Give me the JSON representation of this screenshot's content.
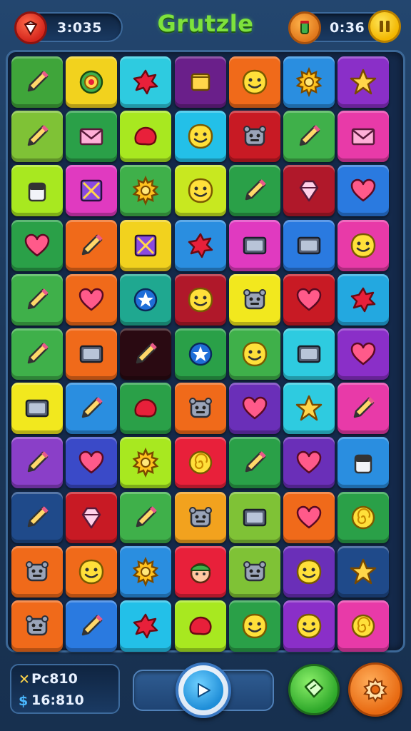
{
  "header": {
    "title": "Grutzle",
    "left_counter": "3:035",
    "right_counter": "0:36"
  },
  "footer": {
    "stat_1_label": "Pc810",
    "stat_2_label": "16:810",
    "stat_1_icon": "cross-icon",
    "stat_2_icon": "dollar-icon"
  },
  "colors": {
    "title": "#7ee23c",
    "board_border": "#3c6897",
    "pause": "#f2b600",
    "play": "#1f8ed8",
    "hint": "#2ea82a",
    "settings": "#e86a12"
  },
  "board": {
    "columns": 7,
    "rows": 11,
    "tiles": [
      [
        {
          "bg": "#3fa53a",
          "icon": "pencil"
        },
        {
          "bg": "#f2d21e",
          "icon": "badge"
        },
        {
          "bg": "#2ecbe0",
          "icon": "splat"
        },
        {
          "bg": "#6a1f8a",
          "icon": "scroll"
        },
        {
          "bg": "#f06a1a",
          "icon": "smiley"
        },
        {
          "bg": "#2a8ee0",
          "icon": "sun"
        },
        {
          "bg": "#8a2fc8",
          "icon": "star"
        }
      ],
      [
        {
          "bg": "#7fc236",
          "icon": "pencil"
        },
        {
          "bg": "#2aa048",
          "icon": "envelope"
        },
        {
          "bg": "#a8e820",
          "icon": "blob"
        },
        {
          "bg": "#23c0e8",
          "icon": "smiley"
        },
        {
          "bg": "#c81a24",
          "icon": "robot"
        },
        {
          "bg": "#3fb04a",
          "icon": "pencil"
        },
        {
          "bg": "#e83aa8",
          "icon": "envelope"
        }
      ],
      [
        {
          "bg": "#a8e820",
          "icon": "jar"
        },
        {
          "bg": "#e03ac0",
          "icon": "crossbox"
        },
        {
          "bg": "#3fb04a",
          "icon": "sun"
        },
        {
          "bg": "#c8e820",
          "icon": "smiley"
        },
        {
          "bg": "#2aa048",
          "icon": "pencil"
        },
        {
          "bg": "#b0182a",
          "icon": "gem"
        },
        {
          "bg": "#2a7ae0",
          "icon": "heart"
        }
      ],
      [
        {
          "bg": "#2aa048",
          "icon": "heart"
        },
        {
          "bg": "#f06a1a",
          "icon": "pencil"
        },
        {
          "bg": "#f2d21e",
          "icon": "crossbox"
        },
        {
          "bg": "#2a8ee0",
          "icon": "splat"
        },
        {
          "bg": "#e03ac0",
          "icon": "tablet"
        },
        {
          "bg": "#2a7ae0",
          "icon": "tablet"
        },
        {
          "bg": "#e83aa8",
          "icon": "smiley"
        }
      ],
      [
        {
          "bg": "#3fb04a",
          "icon": "pencil"
        },
        {
          "bg": "#f06a1a",
          "icon": "heart"
        },
        {
          "bg": "#1fa890",
          "icon": "starcircle"
        },
        {
          "bg": "#b0182a",
          "icon": "smiley"
        },
        {
          "bg": "#f2e81e",
          "icon": "robot"
        },
        {
          "bg": "#c81a24",
          "icon": "heart"
        },
        {
          "bg": "#23a8e0",
          "icon": "splat"
        }
      ],
      [
        {
          "bg": "#3fb04a",
          "icon": "pencil"
        },
        {
          "bg": "#f06a1a",
          "icon": "tablet"
        },
        {
          "bg": "#2a0a12",
          "icon": "pencil"
        },
        {
          "bg": "#2aa048",
          "icon": "starcircle"
        },
        {
          "bg": "#3fb04a",
          "icon": "smiley"
        },
        {
          "bg": "#2ecbe0",
          "icon": "tablet"
        },
        {
          "bg": "#8a2fc8",
          "icon": "heart"
        }
      ],
      [
        {
          "bg": "#f2e81e",
          "icon": "tablet"
        },
        {
          "bg": "#2a8ee0",
          "icon": "pencil"
        },
        {
          "bg": "#2aa048",
          "icon": "blob"
        },
        {
          "bg": "#f06a1a",
          "icon": "robot"
        },
        {
          "bg": "#6a2fb8",
          "icon": "heart"
        },
        {
          "bg": "#2ecbe0",
          "icon": "star"
        },
        {
          "bg": "#e83aa8",
          "icon": "pencil"
        }
      ],
      [
        {
          "bg": "#8a3fc8",
          "icon": "pencil"
        },
        {
          "bg": "#3a4ac8",
          "icon": "heart"
        },
        {
          "bg": "#a8e820",
          "icon": "sun"
        },
        {
          "bg": "#e8203a",
          "icon": "swirl"
        },
        {
          "bg": "#2aa048",
          "icon": "pencil"
        },
        {
          "bg": "#6a2fb8",
          "icon": "heart"
        },
        {
          "bg": "#2a8ee0",
          "icon": "jar"
        }
      ],
      [
        {
          "bg": "#1f4a8a",
          "icon": "pencil"
        },
        {
          "bg": "#c81a24",
          "icon": "gem"
        },
        {
          "bg": "#3fb04a",
          "icon": "pencil"
        },
        {
          "bg": "#f2a21e",
          "icon": "robot"
        },
        {
          "bg": "#7fc236",
          "icon": "tablet"
        },
        {
          "bg": "#f06a1a",
          "icon": "heart"
        },
        {
          "bg": "#2aa048",
          "icon": "swirl"
        }
      ],
      [
        {
          "bg": "#f06a1a",
          "icon": "robot"
        },
        {
          "bg": "#f06a1a",
          "icon": "smiley"
        },
        {
          "bg": "#2a8ee0",
          "icon": "sun"
        },
        {
          "bg": "#e8203a",
          "icon": "face"
        },
        {
          "bg": "#7fc236",
          "icon": "robot"
        },
        {
          "bg": "#6a2fb8",
          "icon": "smiley"
        },
        {
          "bg": "#1f4a8a",
          "icon": "star"
        }
      ],
      [
        {
          "bg": "#f06a1a",
          "icon": "robot"
        },
        {
          "bg": "#2a7ae0",
          "icon": "pencil"
        },
        {
          "bg": "#23c0e8",
          "icon": "splat"
        },
        {
          "bg": "#a8e820",
          "icon": "blob"
        },
        {
          "bg": "#2aa048",
          "icon": "smiley"
        },
        {
          "bg": "#8a2fc8",
          "icon": "smiley"
        },
        {
          "bg": "#e83aa8",
          "icon": "swirl"
        }
      ]
    ]
  }
}
